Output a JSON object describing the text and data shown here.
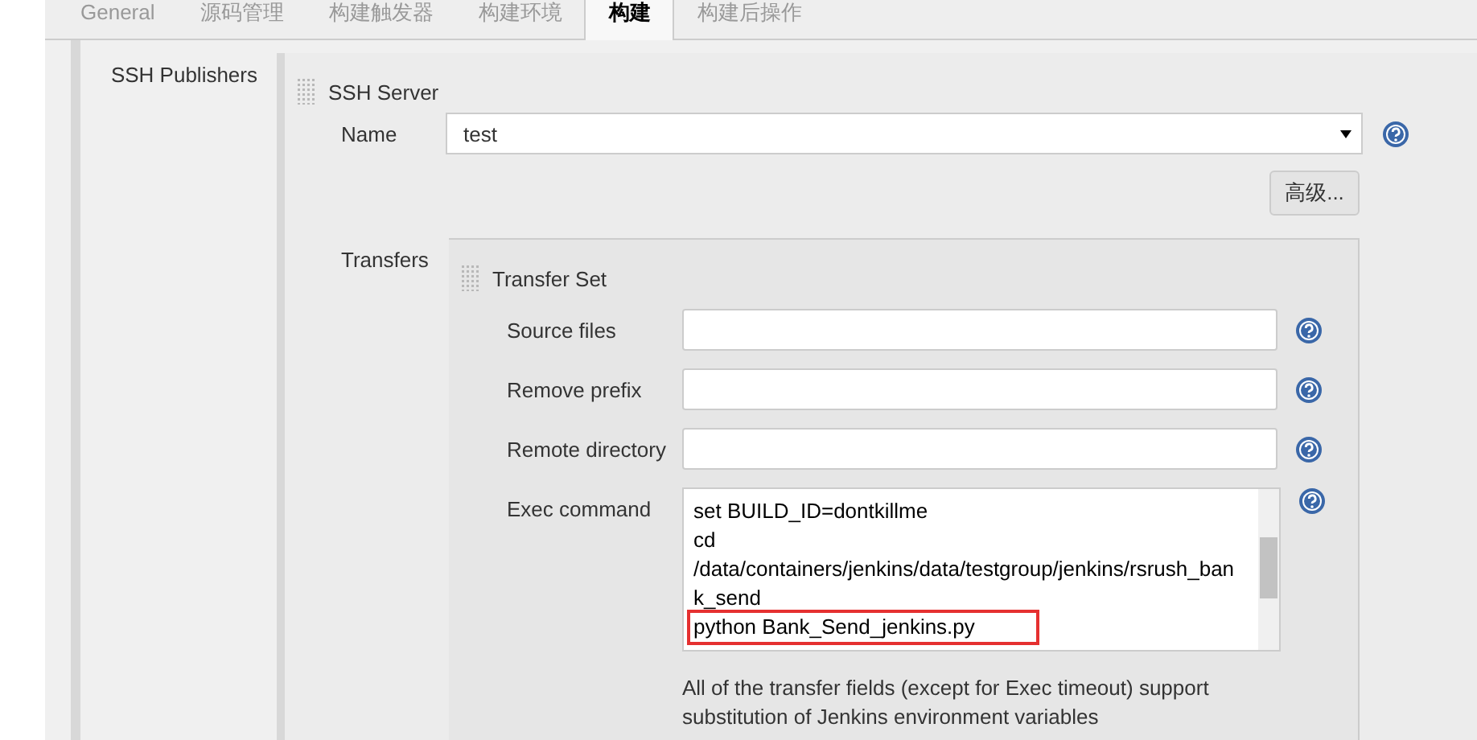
{
  "tabs": [
    {
      "label": "General",
      "selected": false
    },
    {
      "label": "源码管理",
      "selected": false
    },
    {
      "label": "构建触发器",
      "selected": false
    },
    {
      "label": "构建环境",
      "selected": false
    },
    {
      "label": "构建",
      "selected": true
    },
    {
      "label": "构建后操作",
      "selected": false
    }
  ],
  "section_label": "SSH Publishers",
  "ssh_server": {
    "title": "SSH Server",
    "name_label": "Name",
    "name_value": "test",
    "advanced_button": "高级...",
    "transfers_label": "Transfers"
  },
  "transfer_set": {
    "title": "Transfer Set",
    "fields": [
      {
        "label": "Source files"
      },
      {
        "label": "Remove prefix"
      },
      {
        "label": "Remote directory"
      }
    ],
    "exec_label": "Exec command",
    "exec_lines": [
      {
        "text": "set BUILD_ID=dontkillme",
        "highlighted": false
      },
      {
        "text": "cd",
        "highlighted": false
      },
      {
        "text": "/data/containers/jenkins/data/testgroup/jenkins/rsrush_ban",
        "highlighted": false
      },
      {
        "text": "k_send",
        "highlighted": false
      },
      {
        "text": "python Bank_Send_jenkins.py",
        "highlighted": true
      }
    ],
    "note": "All of the transfer fields (except for Exec timeout) support substitution of Jenkins environment variables"
  }
}
